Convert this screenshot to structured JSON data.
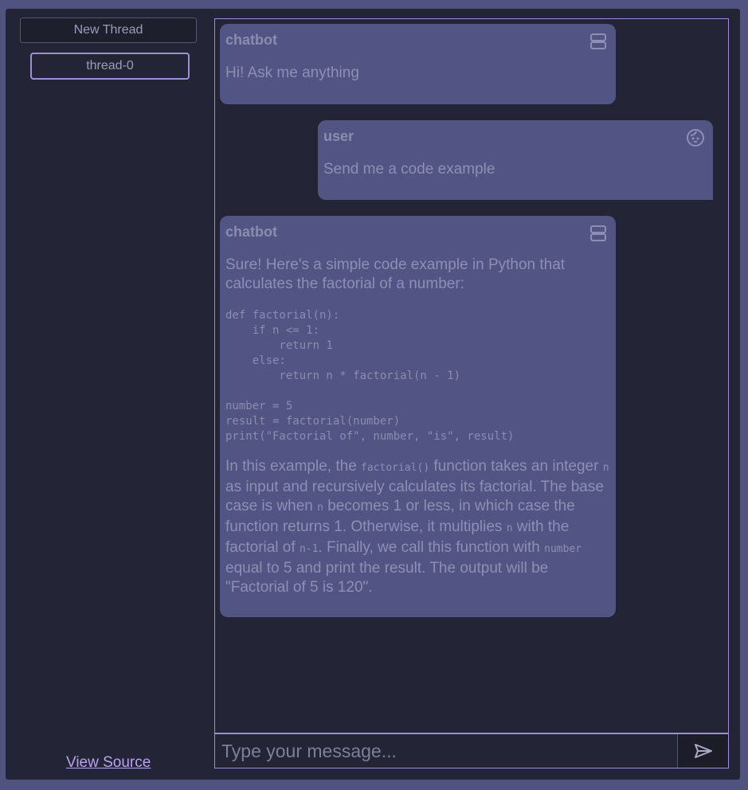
{
  "sidebar": {
    "new_thread_label": "New Thread",
    "threads": [
      {
        "label": "thread-0"
      }
    ],
    "view_source_label": "View Source"
  },
  "messages": [
    {
      "author": "chatbot",
      "icon": "robot-icon",
      "text": "Hi! Ask me anything"
    },
    {
      "author": "user",
      "icon": "user-face-icon",
      "text": "Send me a code example"
    },
    {
      "author": "chatbot",
      "icon": "robot-icon",
      "intro": "Sure! Here's a simple code example in Python that calculates the factorial of a number:",
      "code": "def factorial(n):\n    if n <= 1:\n        return 1\n    else:\n        return n * factorial(n - 1)\n\nnumber = 5\nresult = factorial(number)\nprint(\"Factorial of\", number, \"is\", result)",
      "explanation": {
        "p1": "In this example, the ",
        "c1": "factorial()",
        "p2": " function takes an integer ",
        "c2": "n",
        "p3": " as input and recursively calculates its factorial. The base case is when ",
        "c3": "n",
        "p4": " becomes 1 or less, in which case the function returns 1. Otherwise, it multiplies ",
        "c4": "n",
        "p5": " with the factorial of ",
        "c5": "n-1",
        "p6": ". Finally, we call this function with ",
        "c6": "number",
        "p7": " equal to 5 and print the result. The output will be \"Factorial of 5 is 120\"."
      }
    }
  ],
  "composer": {
    "placeholder": "Type your message...",
    "value": "",
    "send_icon": "send-icon"
  },
  "colors": {
    "background": "#232536",
    "frame": "#505280",
    "bubble": "#525484",
    "accent_border": "#9d8fd6",
    "link": "#b8a2f0"
  }
}
